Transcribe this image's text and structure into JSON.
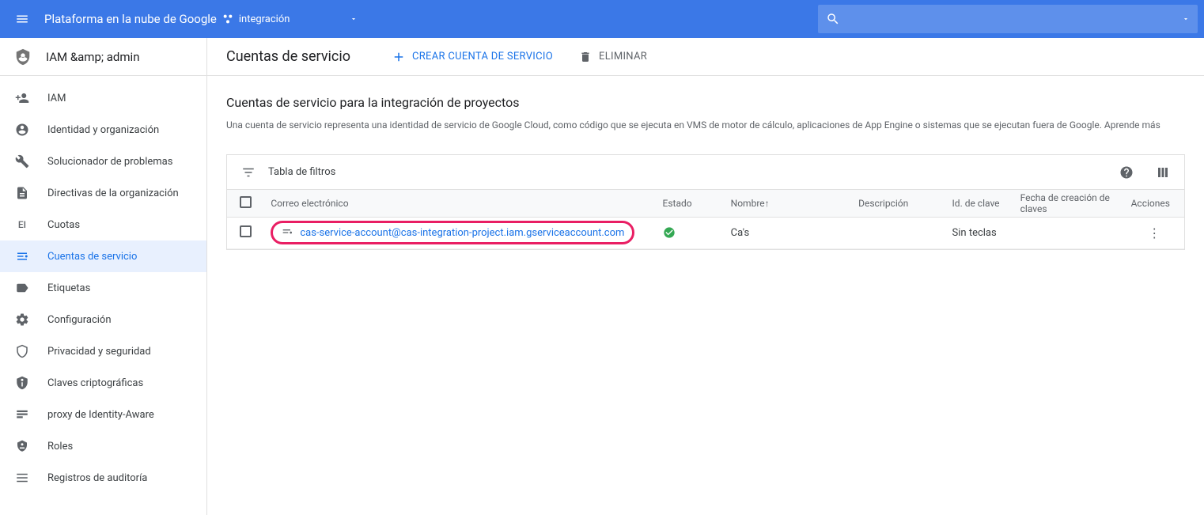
{
  "topbar": {
    "title": "Plataforma en la nube de Google",
    "project_name": "integración",
    "search_placeholder": ""
  },
  "sidebar": {
    "header": "IAM &amp; admin",
    "items": [
      {
        "icon": "person-add",
        "label": "IAM"
      },
      {
        "icon": "account-circle",
        "label": "Identidad y organización"
      },
      {
        "icon": "wrench",
        "label": "Solucionador de problemas"
      },
      {
        "icon": "description",
        "label": "Directivas de la organización"
      },
      {
        "icon": "quotas",
        "label": "Cuotas"
      },
      {
        "icon": "service-account",
        "label": "Cuentas de servicio"
      },
      {
        "icon": "label",
        "label": "Etiquetas"
      },
      {
        "icon": "settings",
        "label": "Configuración"
      },
      {
        "icon": "shield-outline",
        "label": "Privacidad y seguridad"
      },
      {
        "icon": "key-shield",
        "label": "Claves criptográficas"
      },
      {
        "icon": "proxy",
        "label": "proxy de Identity-Aware"
      },
      {
        "icon": "roles",
        "label": "Roles"
      },
      {
        "icon": "audit",
        "label": "Registros de auditoría"
      }
    ]
  },
  "header": {
    "title": "Cuentas de servicio",
    "create_label": "CREAR CUENTA DE SERVICIO",
    "delete_label": "ELIMINAR"
  },
  "page": {
    "subtitle": "Cuentas de servicio para la integración de proyectos",
    "description": "Una cuenta de servicio representa una identidad de servicio de Google Cloud, como código que se ejecuta en VMS de motor de cálculo, aplicaciones de App Engine o sistemas que se ejecutan fuera de Google.",
    "learn_more": "Aprende más"
  },
  "table": {
    "filter_label": "Tabla de filtros",
    "columns": {
      "email": "Correo electrónico",
      "status": "Estado",
      "name": "Nombre",
      "description": "Descripción",
      "key_id": "Id. de clave",
      "key_created": "Fecha de creación de claves",
      "actions": "Acciones"
    },
    "rows": [
      {
        "email": "cas-service-account@cas-integration-project.iam.gserviceaccount.com",
        "status": "ok",
        "name": "Ca's",
        "description": "",
        "key_id": "Sin teclas",
        "key_created": ""
      }
    ]
  }
}
